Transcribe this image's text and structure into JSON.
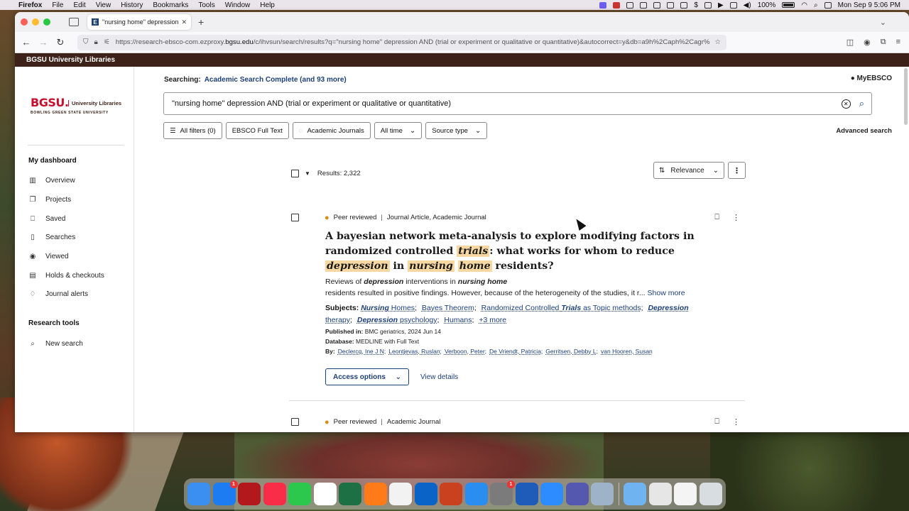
{
  "menubar": {
    "app": "Firefox",
    "items": [
      "File",
      "Edit",
      "View",
      "History",
      "Bookmarks",
      "Tools",
      "Window",
      "Help"
    ],
    "battery": "100%",
    "datetime": "Mon Sep 9  5:06 PM"
  },
  "browser": {
    "tab_title": "\"nursing home\" depression AN",
    "url_prefix": "https://research-ebsco-com.ezproxy.",
    "url_host": "bgsu.edu",
    "url_rest": "/c/ihvsun/search/results?q=\"nursing home\" depression AND (trial or experiment or qualitative or quantitative)&autocorrect=y&db=a9h%2Caph%2Cagr%"
  },
  "site": {
    "library_bar": "BGSU University Libraries",
    "logo": {
      "main": "BGSU.",
      "side": "University Libraries",
      "sub": "BOWLING GREEN STATE UNIVERSITY"
    },
    "dashboard_heading": "My dashboard",
    "nav": [
      {
        "label": "Overview"
      },
      {
        "label": "Projects"
      },
      {
        "label": "Saved"
      },
      {
        "label": "Searches"
      },
      {
        "label": "Viewed"
      },
      {
        "label": "Holds & checkouts"
      },
      {
        "label": "Journal alerts"
      }
    ],
    "tools_heading": "Research tools",
    "new_search": "New search"
  },
  "search": {
    "searching_label": "Searching:",
    "searching_db": "Academic Search Complete (and 93 more)",
    "myebsco": "MyEBSCO",
    "query": "\"nursing home\" depression AND (trial or experiment or qualitative or quantitative)",
    "filters": {
      "all": "All filters (0)",
      "fulltext": "EBSCO Full Text",
      "journals": "Academic Journals",
      "time": "All time",
      "source": "Source type"
    },
    "advanced": "Advanced search"
  },
  "results": {
    "count_label": "Results: 2,322",
    "sort": "Relevance",
    "items": [
      {
        "peer": "Peer reviewed",
        "type": "Journal Article, Academic Journal",
        "title_a": "A bayesian network meta-analysis to explore modifying factors in randomized controlled ",
        "title_hl1": "trials",
        "title_b": ": what works for whom to reduce ",
        "title_hl2": "depression",
        "title_c": " in ",
        "title_hl3": "nursing",
        "title_hl4": "home",
        "title_d": " residents?",
        "abs_a": "Reviews of ",
        "abs_hl1": "depression",
        "abs_b": " interventions in ",
        "abs_hl2": "nursing home",
        "abs_c": "residents resulted in positive findings. However, because of the heterogeneity of the studies, it r...",
        "show_more": "Show more",
        "subjects_label": "Subjects:",
        "subjects": [
          {
            "b": "Nursing",
            "t": " Homes"
          },
          {
            "b": "",
            "t": "Bayes Theorem"
          },
          {
            "b": "",
            "t": "Randomized Controlled ",
            "b2": "Trials",
            "t2": " as Topic methods"
          },
          {
            "b": "Depression",
            "t": " therapy"
          },
          {
            "b": "Depression",
            "t": " psychology"
          },
          {
            "b": "",
            "t": "Humans"
          }
        ],
        "subjects_more": "+3 more",
        "published_label": "Published in:",
        "published": "BMC geriatrics, 2024 Jun 14",
        "database_label": "Database:",
        "database": "MEDLINE with Full Text",
        "by_label": "By:",
        "authors": [
          "Declercq, Ine J N;",
          "Leontjevas, Ruslan;",
          "Verboon, Peter;",
          "De Vriendt, Patricia;",
          "Gerritsen, Debby L;",
          "van Hooren, Susan"
        ],
        "access": "Access options",
        "details": "View details"
      },
      {
        "peer": "Peer reviewed",
        "type": "Academic Journal"
      }
    ]
  },
  "dock": [
    {
      "name": "finder",
      "color": "#3b8ff0"
    },
    {
      "name": "app-store",
      "color": "#1e7cf2",
      "badge": "1"
    },
    {
      "name": "acrobat",
      "color": "#b3181d"
    },
    {
      "name": "music",
      "color": "#fa2d48"
    },
    {
      "name": "facetime",
      "color": "#2cc84d"
    },
    {
      "name": "chrome",
      "color": "#ffffff"
    },
    {
      "name": "excel",
      "color": "#1d7044"
    },
    {
      "name": "firefox",
      "color": "#ff7a18"
    },
    {
      "name": "textedit",
      "color": "#f2f2f2"
    },
    {
      "name": "outlook",
      "color": "#0a64c8"
    },
    {
      "name": "powerpoint",
      "color": "#c9411e"
    },
    {
      "name": "safari",
      "color": "#2a8ef0"
    },
    {
      "name": "settings",
      "color": "#7b7b7b",
      "badge": "1"
    },
    {
      "name": "word",
      "color": "#1f5bb8"
    },
    {
      "name": "zoom",
      "color": "#2d8cff"
    },
    {
      "name": "teams",
      "color": "#5558af"
    },
    {
      "name": "preview",
      "color": "#9fb3c8"
    },
    {
      "name": "folder",
      "color": "#6fb3f0"
    },
    {
      "name": "printer",
      "color": "#e6e6e6"
    },
    {
      "name": "document",
      "color": "#f4f4f4"
    },
    {
      "name": "trash",
      "color": "#d8dde2"
    }
  ]
}
